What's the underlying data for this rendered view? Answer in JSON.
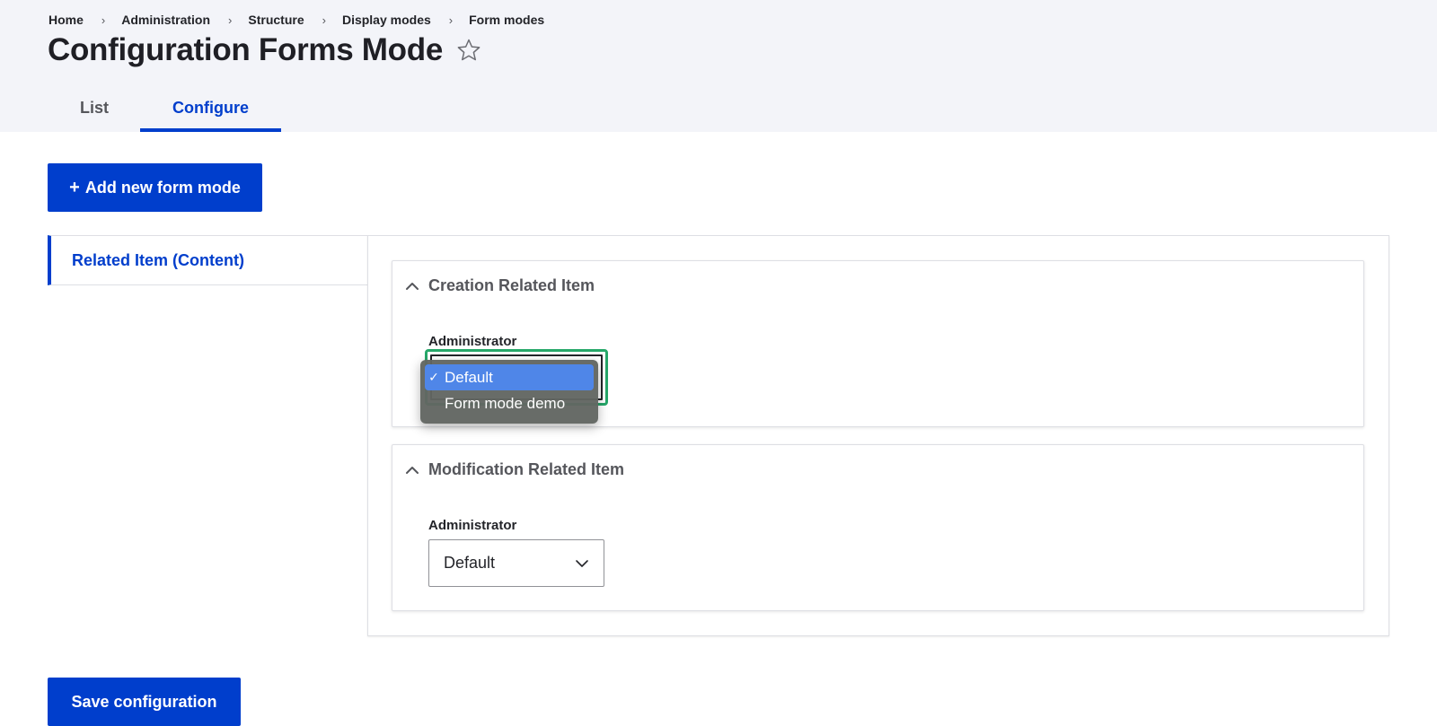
{
  "breadcrumb": [
    "Home",
    "Administration",
    "Structure",
    "Display modes",
    "Form modes"
  ],
  "page": {
    "title": "Configuration Forms Mode"
  },
  "tabs": [
    {
      "label": "List"
    },
    {
      "label": "Configure",
      "active": true
    }
  ],
  "actions": {
    "add_label": "Add new form mode",
    "add_icon": "+",
    "save_label": "Save configuration"
  },
  "vertical_tab": {
    "label": "Related Item (Content)"
  },
  "sections": [
    {
      "summary": "Creation Related Item",
      "field_label": "Administrator",
      "selected": "Default",
      "dropdown_open": true,
      "options": [
        {
          "label": "Default",
          "selected": true
        },
        {
          "label": "Form mode demo",
          "selected": false
        }
      ]
    },
    {
      "summary": "Modification Related Item",
      "field_label": "Administrator",
      "selected": "Default",
      "dropdown_open": false
    }
  ],
  "colors": {
    "accent": "#003ecc",
    "focus_ring": "#26a769",
    "menu_highlight": "#4f86e8"
  }
}
